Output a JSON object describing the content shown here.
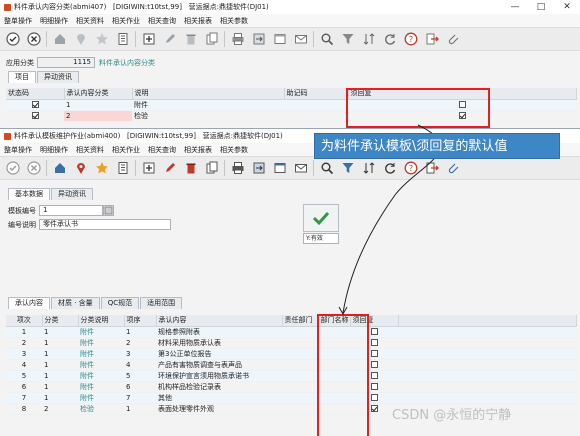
{
  "window1": {
    "title": "料件承认内容分类(abmi407)",
    "program": "[DIGIWIN:t10tst,99]",
    "org": "营运据点:鼎捷软件(DJ01)",
    "menu": [
      "整单操作",
      "明细操作",
      "相关资料",
      "相关作业",
      "相关查询",
      "相关报表",
      "相关参数"
    ],
    "app_class_label": "应用分类",
    "app_class_value": "1115",
    "app_class_desc": "料件承认内容分类",
    "tabs": [
      "项目",
      "异动资讯"
    ],
    "columns": [
      "状态码",
      "承认内容分类",
      "说明",
      "助记码",
      "须回复"
    ],
    "rows": [
      {
        "status": true,
        "code": "1",
        "desc": "附件",
        "memo": "",
        "reply": false
      },
      {
        "status": true,
        "code": "2",
        "desc": "检验",
        "memo": "",
        "reply": true
      }
    ]
  },
  "window2": {
    "title": "料件承认模板维护作业(abmi400)",
    "program": "[DIGIWIN:t10tst,99]",
    "org": "营运据点:鼎捷软件(DJ01)",
    "menu": [
      "整单操作",
      "明细操作",
      "相关资料",
      "相关作业",
      "相关查询",
      "相关报表",
      "相关参数"
    ],
    "top_tabs": [
      "基本数据",
      "异动资讯"
    ],
    "template_no_label": "模板编号",
    "template_no_value": "1",
    "desc_label": "编号说明",
    "desc_value": "零件承认书",
    "status_value": "Y:有效",
    "detail_tabs": [
      "承认内容",
      "材质 · 含量",
      "QC规范",
      "适用范围"
    ],
    "columns": [
      "项次",
      "分类",
      "分类说明",
      "项序",
      "承认内容",
      "责任部门",
      "部门名称",
      "须回复"
    ],
    "rows": [
      {
        "seq": "1",
        "cls": "1",
        "cls_desc": "附件",
        "item": "1",
        "content": "规格参照附表",
        "dept": "",
        "dept_name": "",
        "reply": false
      },
      {
        "seq": "2",
        "cls": "1",
        "cls_desc": "附件",
        "item": "2",
        "content": "材料采用物质承认表",
        "dept": "",
        "dept_name": "",
        "reply": false
      },
      {
        "seq": "3",
        "cls": "1",
        "cls_desc": "附件",
        "item": "3",
        "content": "第3公正单位报告",
        "dept": "",
        "dept_name": "",
        "reply": false
      },
      {
        "seq": "4",
        "cls": "1",
        "cls_desc": "附件",
        "item": "4",
        "content": "产品有害物质调查与表声品",
        "dept": "",
        "dept_name": "",
        "reply": false
      },
      {
        "seq": "5",
        "cls": "1",
        "cls_desc": "附件",
        "item": "5",
        "content": "环境保护宣言须用物质承诺书",
        "dept": "",
        "dept_name": "",
        "reply": false
      },
      {
        "seq": "6",
        "cls": "1",
        "cls_desc": "附件",
        "item": "6",
        "content": "机构样品检验记录表",
        "dept": "",
        "dept_name": "",
        "reply": false
      },
      {
        "seq": "7",
        "cls": "1",
        "cls_desc": "附件",
        "item": "7",
        "content": "其他",
        "dept": "",
        "dept_name": "",
        "reply": false
      },
      {
        "seq": "8",
        "cls": "2",
        "cls_desc": "检验",
        "item": "1",
        "content": "表面处理零件外观",
        "dept": "",
        "dept_name": "",
        "reply": true
      }
    ]
  },
  "callout_text": "为料件承认模板\\须回复的默认值",
  "watermark": "CSDN @永恒的宁静",
  "window_controls": [
    "—",
    "□",
    "✕"
  ],
  "colors": {
    "accent": "#3f86c6",
    "highlight_red": "#e32020",
    "teal_text": "#2a8a8a"
  },
  "toolbar_icons": [
    "confirm-icon",
    "cancel-icon",
    "home-icon",
    "location-pin-icon",
    "star-icon",
    "list-icon",
    "add-icon",
    "edit-icon",
    "delete-icon",
    "copy-icon",
    "print-icon",
    "export-icon",
    "attachment-window-icon",
    "mail-icon",
    "search-icon",
    "filter-icon",
    "sort-icon",
    "refresh-icon",
    "help-icon",
    "exit-icon",
    "clip-icon"
  ]
}
